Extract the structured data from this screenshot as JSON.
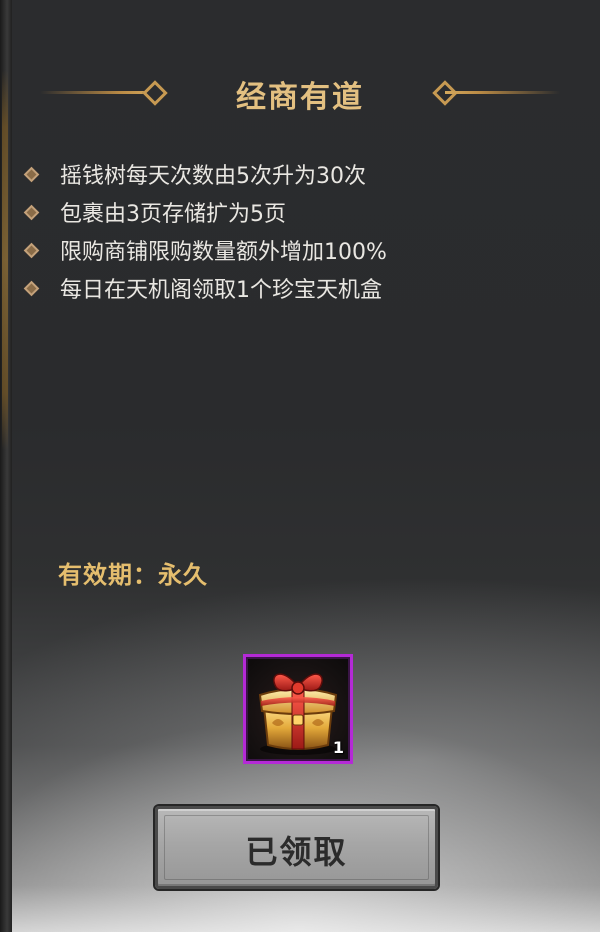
{
  "panel": {
    "title": "经商有道",
    "perks": [
      "摇钱树每天次数由5次升为30次",
      "包裹由3页存储扩为5页",
      "限购商铺限购数量额外增加100%",
      "每日在天机阁领取1个珍宝天机盒"
    ],
    "validity": "有效期：永久",
    "reward": {
      "icon": "gift-chest-icon",
      "count": "1",
      "rarity_color": "#b42ad6"
    },
    "claim_button_label": "已领取"
  },
  "colors": {
    "title": "#e3c081",
    "validity": "#e5be6e",
    "perk_text": "#e9e7e2",
    "accent_gold": "#c79a52"
  }
}
